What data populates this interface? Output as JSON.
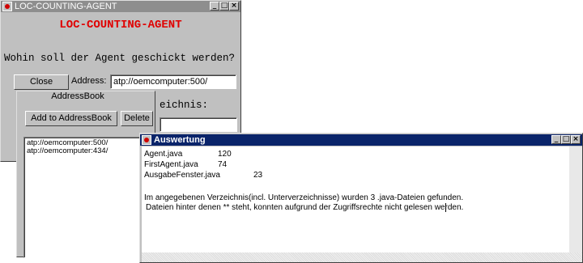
{
  "agent_window": {
    "title": "LOC-COUNTING-AGENT",
    "heading": "LOC-COUNTING-AGENT",
    "question": "Wohin soll der Agent geschickt werden?",
    "close_label": "Close",
    "address_label": "Address:",
    "address_value": "atp://oemcomputer:500/",
    "hidden_label_fragment": "eichnis:"
  },
  "addressbook": {
    "title": "AddressBook",
    "add_label": "Add to AddressBook",
    "delete_label": "Delete",
    "entries": [
      "atp://oemcomputer:500/",
      "atp://oemcomputer:434/"
    ]
  },
  "auswertung_window": {
    "title": "Auswertung",
    "rows": [
      {
        "file": "Agent.java",
        "loc": "120"
      },
      {
        "file": "FirstAgent.java",
        "loc": "74"
      },
      {
        "file": "AusgabeFenster.java",
        "loc": "23"
      }
    ],
    "summary_line1": "Im angegebenen Verzeichnis(incl. Unterverzeichnisse) wurden 3 .java-Dateien gefunden.",
    "summary_line2": "Dateien hinter denen ** steht, konnten aufgrund der Zugriffsrechte nicht gelesen werden."
  },
  "window_buttons": {
    "minimize": "_",
    "maximize": "□",
    "close": "×"
  },
  "colors": {
    "active_title": "#0a246a",
    "inactive_title": "#8e8e8e",
    "heading_red": "#e00000"
  }
}
